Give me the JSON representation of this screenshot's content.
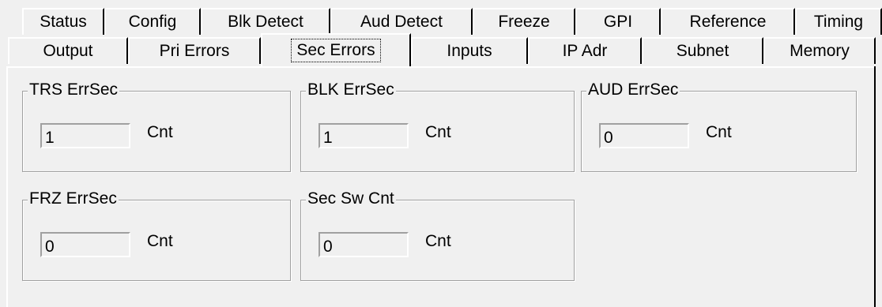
{
  "tabs_row1": [
    "Status",
    "Config",
    "Blk Detect",
    "Aud Detect",
    "Freeze",
    "GPI",
    "Reference",
    "Timing"
  ],
  "tabs_row2": [
    "Output",
    "Pri Errors",
    "Sec Errors",
    "Inputs",
    "IP Adr",
    "Subnet",
    "Memory"
  ],
  "selected_tab": "Sec Errors",
  "groups": [
    {
      "title": "TRS ErrSec",
      "value": "1",
      "unit": "Cnt"
    },
    {
      "title": "BLK ErrSec",
      "value": "1",
      "unit": "Cnt"
    },
    {
      "title": "AUD ErrSec",
      "value": "0",
      "unit": "Cnt"
    },
    {
      "title": "FRZ ErrSec",
      "value": "0",
      "unit": "Cnt"
    },
    {
      "title": "Sec Sw Cnt",
      "value": "0",
      "unit": "Cnt"
    }
  ]
}
